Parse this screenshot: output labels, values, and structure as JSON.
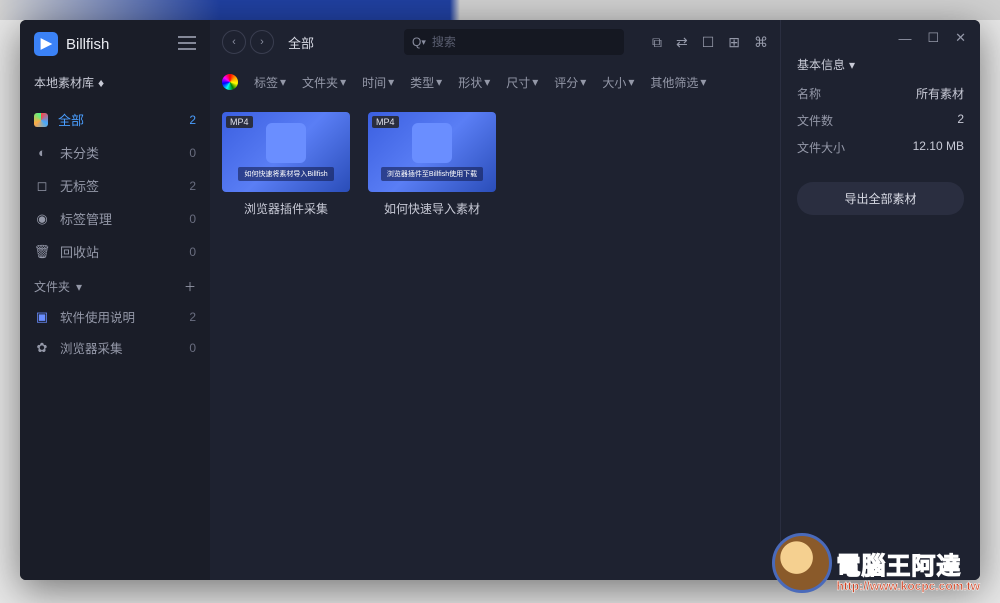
{
  "app": {
    "name": "Billfish"
  },
  "sidebar": {
    "library_label": "本地素材库",
    "items": [
      {
        "label": "全部",
        "count": "2",
        "active": true
      },
      {
        "label": "未分类",
        "count": "0"
      },
      {
        "label": "无标签",
        "count": "2"
      },
      {
        "label": "标签管理",
        "count": "0"
      },
      {
        "label": "回收站",
        "count": "0"
      }
    ],
    "folders_label": "文件夹",
    "folders": [
      {
        "label": "软件使用说明",
        "count": "2"
      },
      {
        "label": "浏览器采集",
        "count": "0"
      }
    ]
  },
  "toolbar": {
    "breadcrumb": "全部",
    "search_placeholder": "搜索"
  },
  "filters": {
    "items": [
      "标签",
      "文件夹",
      "时间",
      "类型",
      "形状",
      "尺寸",
      "评分",
      "大小",
      "其他筛选"
    ]
  },
  "content": {
    "items": [
      {
        "badge": "MP4",
        "label": "浏览器插件采集"
      },
      {
        "badge": "MP4",
        "label": "如何快速导入素材"
      }
    ]
  },
  "info": {
    "title": "基本信息",
    "rows": [
      {
        "k": "名称",
        "v": "所有素材"
      },
      {
        "k": "文件数",
        "v": "2"
      },
      {
        "k": "文件大小",
        "v": "12.10 MB"
      }
    ],
    "export_label": "导出全部素材"
  },
  "watermark": {
    "line1": "電腦王阿達",
    "line2": "http://www.kocpc.com.tw"
  }
}
